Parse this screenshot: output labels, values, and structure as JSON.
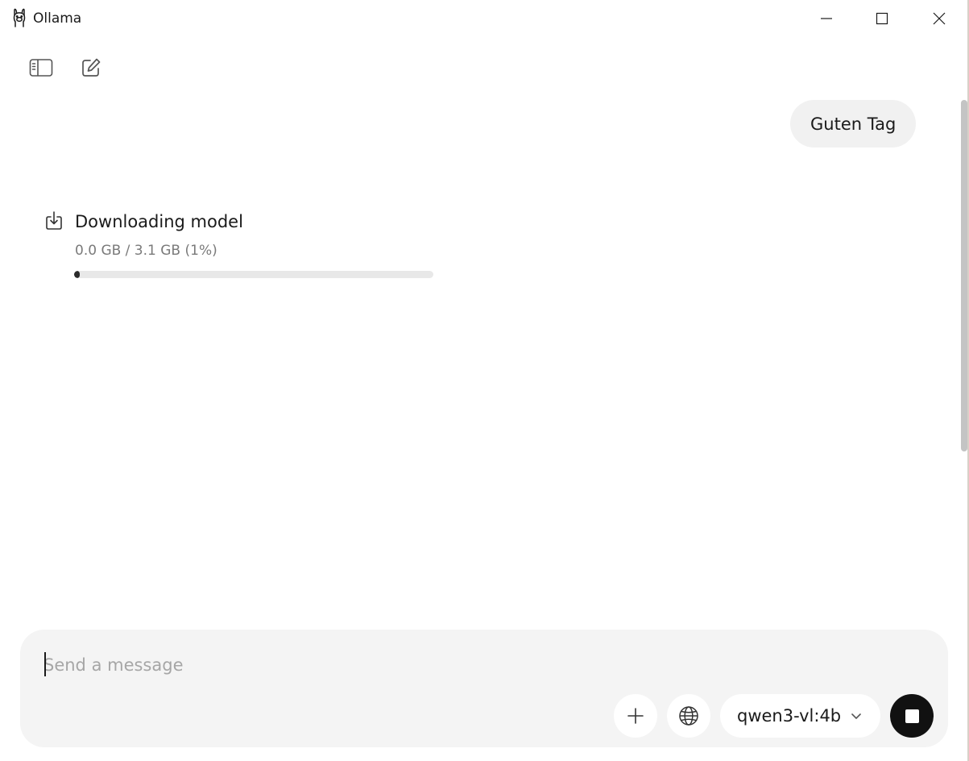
{
  "window": {
    "title": "Ollama",
    "icons": {
      "app": "llama-logo-icon",
      "minimize": "minimize-icon",
      "maximize": "maximize-icon",
      "close": "close-icon"
    }
  },
  "toolbar": {
    "icons": {
      "sidebar": "sidebar-toggle-icon",
      "new_chat": "new-chat-icon"
    }
  },
  "conversation": {
    "user_message": "Guten Tag",
    "download": {
      "icon": "download-icon",
      "title": "Downloading model",
      "progress_text": "0.0 GB / 3.1 GB (1%)",
      "progress_percent": 1
    }
  },
  "composer": {
    "placeholder": "Send a message",
    "value": "",
    "model": "qwen3-vl:4b",
    "icons": {
      "attach": "plus-icon",
      "web_search": "globe-icon",
      "model_dropdown": "chevron-down-icon",
      "stop": "stop-icon"
    }
  },
  "colors": {
    "bubble": "#f1f1f1",
    "composer": "#f4f4f4",
    "progress_fill": "#2b2b2b",
    "progress_track": "#e8e8e8",
    "stop_button": "#111111"
  }
}
